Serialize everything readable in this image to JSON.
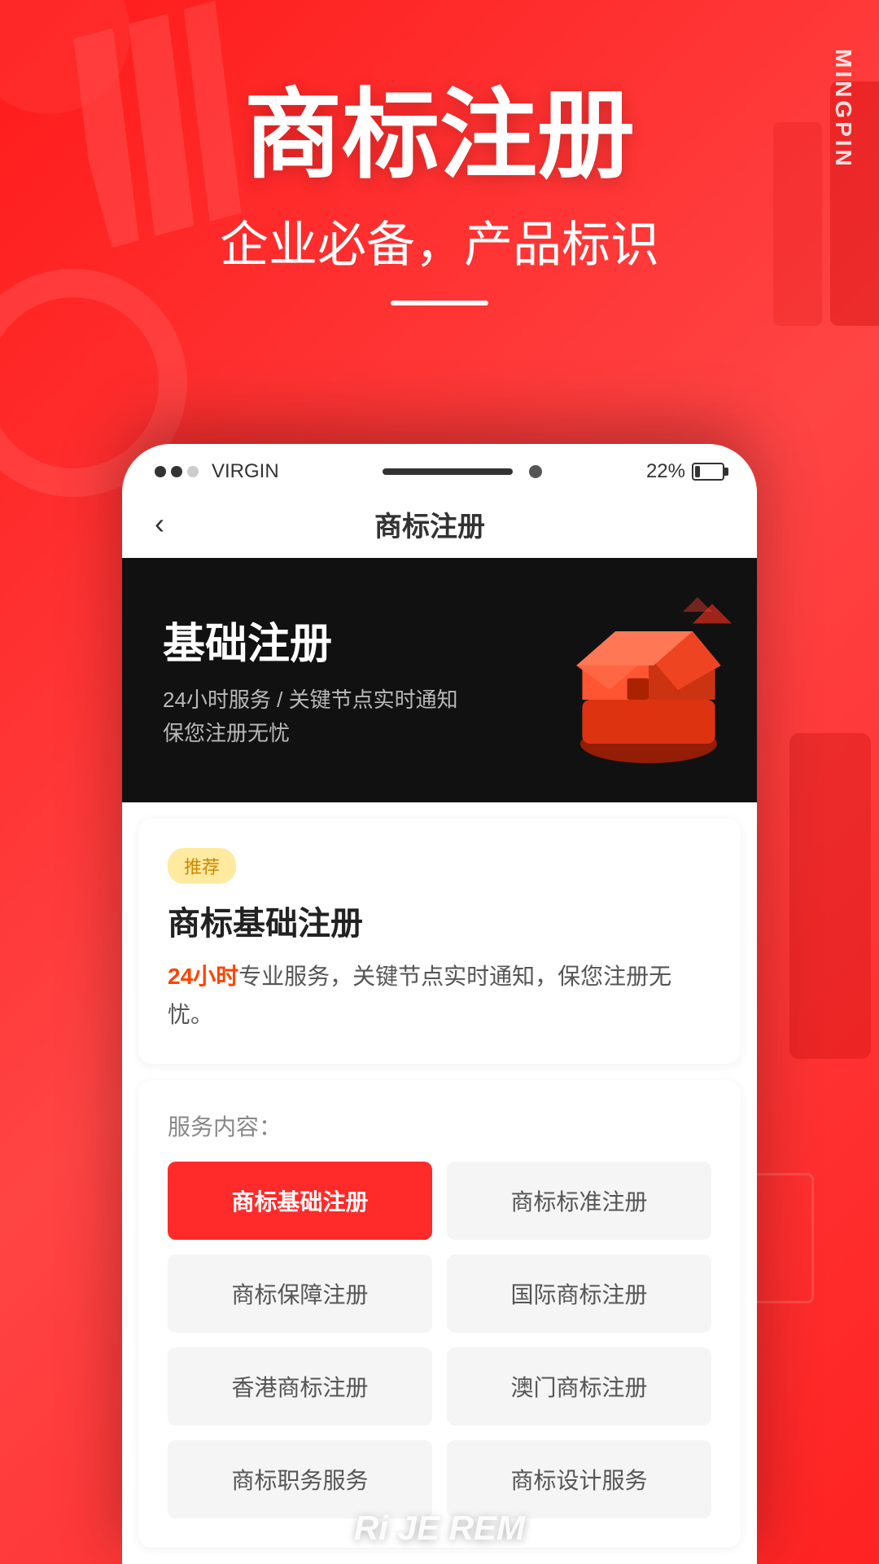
{
  "brand": {
    "name": "MINGPIN",
    "vertical_text": "MINGPIN"
  },
  "hero": {
    "title": "商标注册",
    "subtitle": "企业必备，产品标识",
    "divider": true
  },
  "status_bar": {
    "carrier": "VIRGIN",
    "battery_percent": "22%",
    "signal": "●●○"
  },
  "nav": {
    "back_label": "‹",
    "title": "商标注册"
  },
  "banner": {
    "title": "基础注册",
    "desc_line1": "24小时服务 / 关键节点实时通知",
    "desc_line2": "保您注册无忧"
  },
  "product_card": {
    "tag": "推荐",
    "title": "商标基础注册",
    "desc_prefix": "",
    "desc_highlight": "24小时",
    "desc_suffix": "专业服务，关键节点实时通知，保您注册无忧。"
  },
  "service_section": {
    "label": "服务内容：",
    "buttons": [
      {
        "id": "basic",
        "text": "商标基础注册",
        "active": true
      },
      {
        "id": "standard",
        "text": "商标标准注册",
        "active": false
      },
      {
        "id": "guarantee",
        "text": "商标保障注册",
        "active": false
      },
      {
        "id": "international",
        "text": "国际商标注册",
        "active": false
      },
      {
        "id": "hongkong",
        "text": "香港商标注册",
        "active": false
      },
      {
        "id": "macao",
        "text": "澳门商标注册",
        "active": false
      },
      {
        "id": "agency",
        "text": "商标职务服务",
        "active": false
      },
      {
        "id": "design",
        "text": "商标设计服务",
        "active": false
      }
    ]
  },
  "bottom": {
    "text": "Ri JE REM"
  }
}
